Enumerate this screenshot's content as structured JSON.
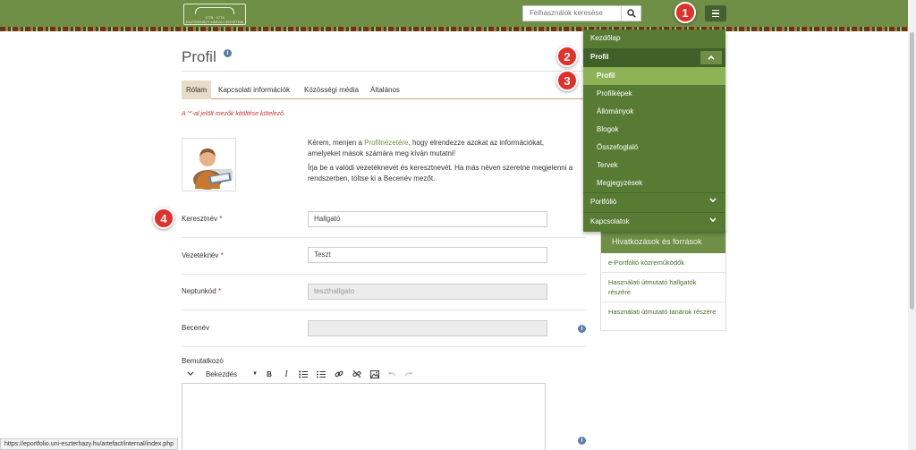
{
  "header": {
    "logo_line1": "1775 · 1774",
    "logo_line2": "ESZTERHÁZY KÁROLY EGYETEM",
    "search_placeholder": "Felhasználók keresése"
  },
  "badges": [
    "1",
    "2",
    "3",
    "4"
  ],
  "page": {
    "title": "Profil",
    "info_symbol": "i",
    "tabs": [
      {
        "label": "Rólam",
        "active": true
      },
      {
        "label": "Kapcsolati információk",
        "active": false
      },
      {
        "label": "Közösségi média",
        "active": false
      },
      {
        "label": "Általános",
        "active": false
      }
    ],
    "required_note": "A '*'-al jelölt mezők kitöltése kötelező.",
    "intro_p1_prefix": "Kérem, menjen a ",
    "intro_p1_link": "Profilnézetére",
    "intro_p1_suffix": ", hogy elrendezze azokat az információkat, amelyeket mások számára meg kíván mutatni!",
    "intro_p2": "Írja be a valódi vezetéknevét és keresztnevét. Ha más néven szeretne megjelenni a rendszerben, töltse ki a Becenév mezőt.",
    "fields": [
      {
        "label": "Keresztnév",
        "required": "*",
        "value": "Hallgató"
      },
      {
        "label": "Vezetéknév",
        "required": "*",
        "value": "Teszt"
      },
      {
        "label": "Neptunkód",
        "required": "*",
        "value": "teszthallgato"
      },
      {
        "label": "Becenév",
        "required": "",
        "value": ""
      }
    ],
    "bio_label": "Bemutatkozó",
    "editor_format": "Bekezdés"
  },
  "menu": {
    "items_top": [
      "Kezdőlap",
      "Profil"
    ],
    "profil_sub": [
      "Profil",
      "Profilképek",
      "Állományok",
      "Blogok",
      "Összefoglaló",
      "Tervek",
      "Megjegyzések"
    ],
    "items_bottom": [
      "Portfólió",
      "Kapcsolatok"
    ]
  },
  "sidebar": {
    "title": "Hivatkozások és források",
    "links": [
      "e-Portfólió közreműködők",
      "Használati útmutató hallgatók részére",
      "Használati útmutató tanárok részére"
    ]
  },
  "status_url": "https://eportfolio.uni-eszterhazy.hu/artefact/internal/index.php",
  "colors": {
    "header": "#6f8e46",
    "menu": "#587b34",
    "menu_active": "#8db356",
    "badge": "#e0322c",
    "link": "#6f8e46"
  }
}
